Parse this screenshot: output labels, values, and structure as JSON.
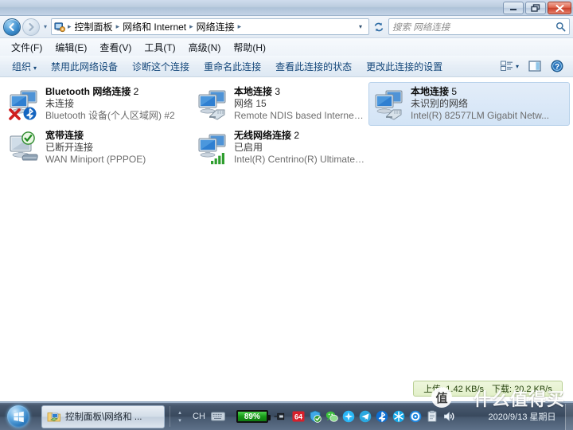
{
  "window": {
    "controls": {
      "minimize": "Minimize",
      "restore": "Restore",
      "close": "Close"
    }
  },
  "address": {
    "back": "back-arrow",
    "forward": "forward-arrow",
    "history_caret": "▾",
    "crumbs": [
      "控制面板",
      "网络和 Internet",
      "网络连接"
    ],
    "separator": "▸",
    "dropdown": "▾",
    "refresh": "refresh-icon"
  },
  "search": {
    "placeholder": "搜索 网络连接",
    "value": "",
    "icon": "magnifier-icon"
  },
  "menubar": {
    "items": [
      "文件(F)",
      "编辑(E)",
      "查看(V)",
      "工具(T)",
      "高级(N)",
      "帮助(H)"
    ]
  },
  "toolbar": {
    "organize": "组织",
    "organize_caret": "▾",
    "items": [
      "禁用此网络设备",
      "诊断这个连接",
      "重命名此连接",
      "查看此连接的状态",
      "更改此连接的设置"
    ],
    "view_caret": "▾",
    "view_icon": "view-options-icon",
    "preview_icon": "preview-pane-icon",
    "help_icon": "help-icon"
  },
  "connections": [
    {
      "name": "Bluetooth 网络连接",
      "suffix": "2",
      "status": "未连接",
      "device": "Bluetooth 设备(个人区域网) #2",
      "icon": "network-adapter-icon",
      "overlay": "red-x-icon",
      "badge": "bluetooth-icon",
      "selected": false
    },
    {
      "name": "本地连接",
      "suffix": "3",
      "status": "网络  15",
      "device": "Remote NDIS based Internet ...",
      "icon": "network-adapter-icon",
      "overlay": "",
      "badge": "ethernet-plug-icon",
      "selected": false
    },
    {
      "name": "本地连接",
      "suffix": "5",
      "status": "未识别的网络",
      "device": "Intel(R) 82577LM Gigabit Netw...",
      "icon": "network-adapter-icon",
      "overlay": "",
      "badge": "ethernet-plug-icon",
      "selected": true
    },
    {
      "name": "宽带连接",
      "suffix": "",
      "status": "已断开连接",
      "device": "WAN Miniport (PPPOE)",
      "icon": "dialup-adapter-icon",
      "overlay": "green-check-icon",
      "badge": "modem-icon",
      "selected": false
    },
    {
      "name": "无线网络连接",
      "suffix": "2",
      "status": "已启用",
      "device": "Intel(R) Centrino(R) Ultimate-N...",
      "icon": "network-adapter-icon",
      "overlay": "",
      "badge": "wifi-bars-icon",
      "selected": false
    }
  ],
  "net_tooltip": {
    "upload": "上传: 1.42 KB/s",
    "download": "下载: 20.2 KB/s"
  },
  "taskbar": {
    "start": "start-orb",
    "task_button": {
      "label": "控制面板\\网络和 ...",
      "icon": "explorer-network-icon"
    },
    "tray_scroll_up": "▴",
    "tray_scroll_down": "▾",
    "ime": {
      "lang": "CH",
      "keyboard_icon": "keyboard-icon"
    },
    "battery": {
      "percent": "89%",
      "plug_icon": "power-plug-icon"
    },
    "tray_icons": [
      "64-antivirus-icon",
      "shield-green-icon",
      "wechat-icon",
      "nvidia-icon",
      "telegram-icon",
      "bluetooth-icon",
      "snowflake-icon",
      "settings-gear-icon",
      "clipboard-icon",
      "volume-icon"
    ],
    "clock": "2020/9/13 星期日",
    "show_desktop": "show-desktop-button"
  },
  "watermark": {
    "text": "什么值得买",
    "mark": "值"
  },
  "colors": {
    "accent": "#14477a",
    "selection": "#d3e4f6",
    "battery_green": "#199a19",
    "tooltip_bg": "#e2f0c9",
    "close_red": "#c8412c"
  }
}
